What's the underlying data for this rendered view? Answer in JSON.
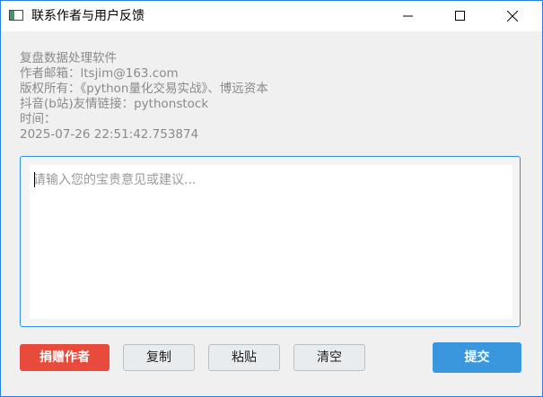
{
  "window": {
    "title": "联系作者与用户反馈",
    "controls": [
      "minimize",
      "maximize",
      "close"
    ]
  },
  "info": {
    "app_name": "复盘数据处理软件",
    "email": "作者邮箱：ltsjim@163.com",
    "copyright": "版权所有：《python量化交易实战》、博远资本",
    "douyin": "抖音(b站)友情链接：pythonstock",
    "time_label": "时间：",
    "time_value": "2025-07-26 22:51:42.753874"
  },
  "feedback": {
    "placeholder": "请输入您的宝贵意见或建议...",
    "value": ""
  },
  "buttons": {
    "donate": "捐赠作者",
    "copy": "复制",
    "paste": "粘贴",
    "clear": "清空",
    "submit": "提交"
  },
  "colors": {
    "donate": "#e84a3c",
    "submit": "#3a97de",
    "frame_border": "#2f8fe6",
    "info_text": "#8a8a8a"
  }
}
